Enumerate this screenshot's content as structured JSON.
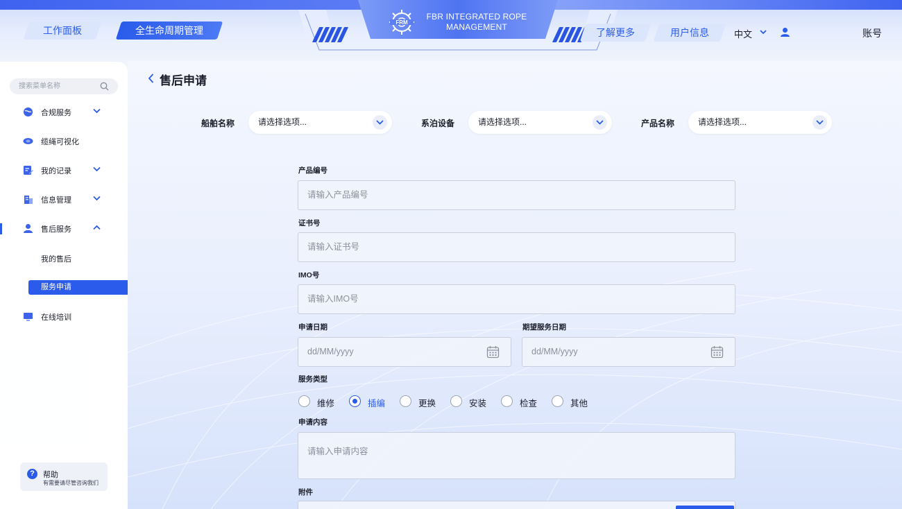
{
  "header": {
    "tab_workbench": "工作面板",
    "tab_lifecycle": "全生命周期管理",
    "logo_line1": "FBR INTEGRATED ROPE",
    "logo_line2": "MANAGEMENT",
    "learn_more": "了解更多",
    "user_info": "用户信息",
    "language": "中文",
    "account": "账号"
  },
  "sidebar": {
    "search_placeholder": "搜索菜单名称",
    "items": [
      {
        "label": "合规服务",
        "icon": "globe-icon"
      },
      {
        "label": "缆绳可视化",
        "icon": "rope-icon"
      },
      {
        "label": "我的记录",
        "icon": "record-icon"
      },
      {
        "label": "信息管理",
        "icon": "building-icon"
      },
      {
        "label": "售后服务",
        "icon": "user-icon"
      },
      {
        "label": "在线培训",
        "icon": "monitor-icon"
      }
    ],
    "sub_items": [
      {
        "label": "我的售后"
      },
      {
        "label": "服务申请"
      }
    ],
    "help": {
      "title": "帮助",
      "subtitle": "有需要请尽管咨询我们"
    }
  },
  "page": {
    "title": "售后申请",
    "filters": [
      {
        "label": "船舶名称",
        "value": "请选择选项..."
      },
      {
        "label": "系泊设备",
        "value": "请选择选项..."
      },
      {
        "label": "产品名称",
        "value": "请选择选项..."
      }
    ],
    "form": {
      "product_no_label": "产品编号",
      "product_no_placeholder": "请输入产品编号",
      "cert_no_label": "证书号",
      "cert_no_placeholder": "请输入证书号",
      "imo_label": "IMO号",
      "imo_placeholder": "请输入IMO号",
      "apply_date_label": "申请日期",
      "apply_date_placeholder": "dd/MM/yyyy",
      "expect_date_label": "期望服务日期",
      "expect_date_placeholder": "dd/MM/yyyy",
      "service_type_label": "服务类型",
      "service_types": [
        "维修",
        "插编",
        "更换",
        "安装",
        "检查",
        "其他"
      ],
      "selected_service_type": "插编",
      "content_label": "申请内容",
      "content_placeholder": "请输入申请内容",
      "attachment_label": "附件"
    }
  },
  "colors": {
    "accent": "#2a5bea",
    "background": "#eef3fc"
  }
}
